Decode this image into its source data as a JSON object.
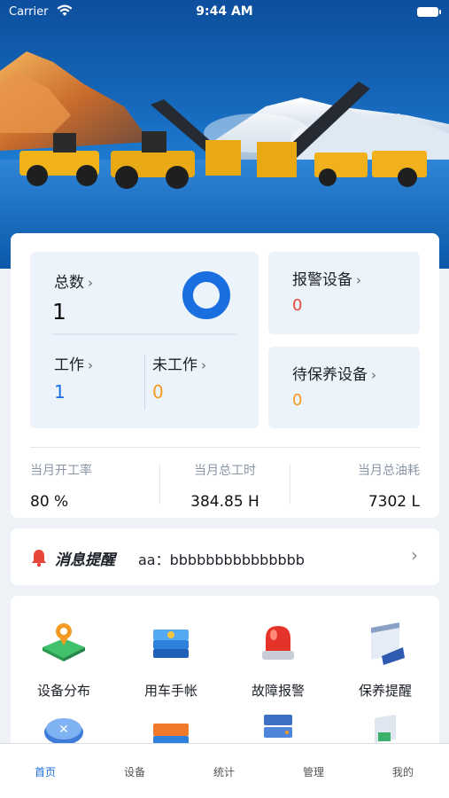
{
  "status_bar": {
    "carrier": "Carrier",
    "time": "9:44 AM"
  },
  "stats": {
    "total": {
      "label": "总数",
      "value": "1"
    },
    "working": {
      "label": "工作",
      "value": "1"
    },
    "idle": {
      "label": "未工作",
      "value": "0"
    },
    "alarm": {
      "label": "报警设备",
      "value": "0"
    },
    "maintenance": {
      "label": "待保养设备",
      "value": "0"
    },
    "chevron": "›",
    "metrics": [
      {
        "label": "当月开工率",
        "value": "80 %"
      },
      {
        "label": "当月总工时",
        "value": "384.85 H"
      },
      {
        "label": "当月总油耗",
        "value": "7302 L"
      }
    ]
  },
  "message": {
    "title": "消息提醒",
    "text": "aa：bbbbbbbbbbbbbbb",
    "arrow": "›"
  },
  "features": [
    {
      "label": "设备分布",
      "icon": "map-location-icon"
    },
    {
      "label": "用车手帐",
      "icon": "books-icon"
    },
    {
      "label": "故障报警",
      "icon": "alarm-light-icon"
    },
    {
      "label": "保养提醒",
      "icon": "calendar-icon"
    },
    {
      "label": "",
      "icon": "shield-check-icon"
    },
    {
      "label": "",
      "icon": "books-stack-icon"
    },
    {
      "label": "",
      "icon": "server-icon"
    },
    {
      "label": "",
      "icon": "document-icon"
    }
  ],
  "tabs": [
    {
      "label": "首页",
      "active": true
    },
    {
      "label": "设备",
      "active": false
    },
    {
      "label": "统计",
      "active": false
    },
    {
      "label": "管理",
      "active": false
    },
    {
      "label": "我的",
      "active": false
    }
  ],
  "colors": {
    "accent": "#1a6fe0",
    "warning": "#f59a23",
    "danger": "#e5473a"
  }
}
